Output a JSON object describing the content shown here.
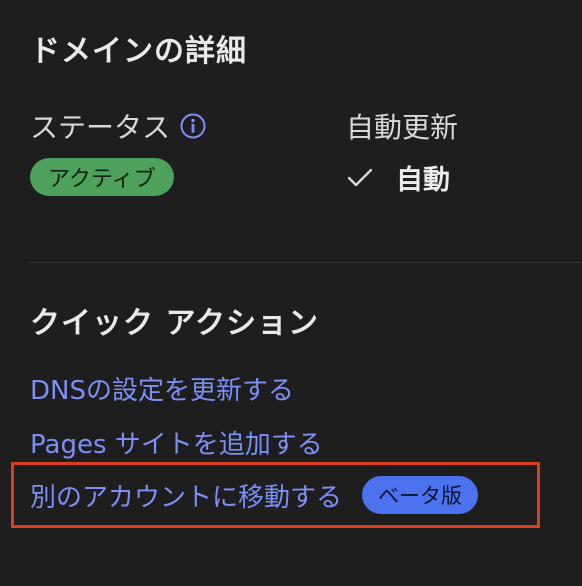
{
  "domain_details": {
    "title": "ドメインの詳細",
    "status_label": "ステータス",
    "status_info_icon": "info-icon",
    "status_value": "アクティブ",
    "auto_renew_label": "自動更新",
    "auto_renew_icon": "checkmark-icon",
    "auto_renew_value": "自動"
  },
  "quick_actions": {
    "title": "クイック アクション",
    "links": {
      "dns": "DNSの設定を更新する",
      "pages": "Pages サイトを追加する",
      "move": "別のアカウントに移動する"
    },
    "beta_badge": "ベータ版"
  },
  "colors": {
    "background": "#1e1e1f",
    "link": "#7c8ff6",
    "active_badge": "#4ea05d",
    "beta_badge": "#4b72ef",
    "highlight": "#d8401f"
  }
}
